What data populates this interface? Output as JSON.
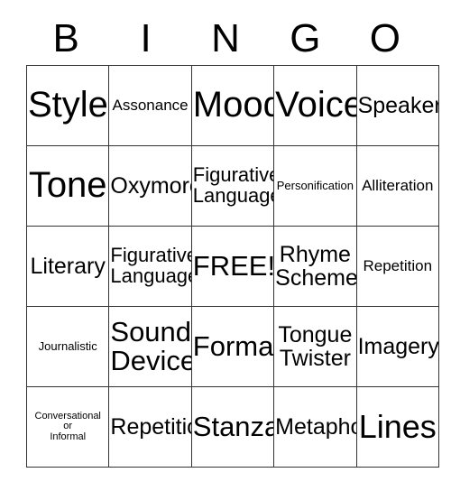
{
  "card": {
    "header_letters": [
      "B",
      "I",
      "N",
      "G",
      "O"
    ],
    "rows": [
      [
        {
          "text": "Style",
          "size": "fs-xxl"
        },
        {
          "text": "Assonance",
          "size": "fs-xs"
        },
        {
          "text": "Mood",
          "size": "fs-xxl"
        },
        {
          "text": "Voice",
          "size": "fs-xxl"
        },
        {
          "text": "Speaker",
          "size": "fs-md"
        }
      ],
      [
        {
          "text": "Tone",
          "size": "fs-xxl"
        },
        {
          "text": "Oxymoron",
          "size": "fs-md"
        },
        {
          "text": "Figurative\nLanguage",
          "size": "fs-sm"
        },
        {
          "text": "Personification",
          "size": "fs-xxs"
        },
        {
          "text": "Alliteration",
          "size": "fs-xs"
        }
      ],
      [
        {
          "text": "Literary",
          "size": "fs-md"
        },
        {
          "text": "Figurative\nLanguage",
          "size": "fs-sm"
        },
        {
          "text": "FREE!",
          "size": "fs-lg"
        },
        {
          "text": "Rhyme\nScheme",
          "size": "fs-md"
        },
        {
          "text": "Repetition",
          "size": "fs-xs"
        }
      ],
      [
        {
          "text": "Journalistic",
          "size": "fs-xxs"
        },
        {
          "text": "Sound\nDevice",
          "size": "fs-lg"
        },
        {
          "text": "Formal",
          "size": "fs-lg"
        },
        {
          "text": "Tongue\nTwister",
          "size": "fs-md"
        },
        {
          "text": "Imagery",
          "size": "fs-md"
        }
      ],
      [
        {
          "text": "Conversational\nor\nInformal",
          "size": "fs-tiny"
        },
        {
          "text": "Repetition",
          "size": "fs-md"
        },
        {
          "text": "Stanza",
          "size": "fs-lg"
        },
        {
          "text": "Metaphor",
          "size": "fs-md"
        },
        {
          "text": "Lines",
          "size": "fs-xl"
        }
      ]
    ]
  },
  "colors": {
    "border": "#333333",
    "text": "#000000",
    "background": "#ffffff"
  }
}
